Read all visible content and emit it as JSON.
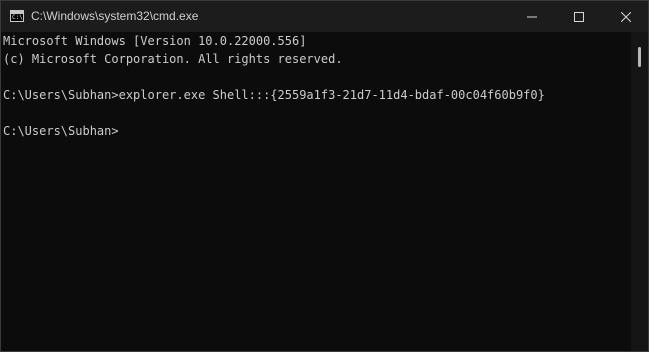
{
  "window": {
    "title": "C:\\Windows\\system32\\cmd.exe",
    "icon": "command-prompt-icon"
  },
  "caption_buttons": {
    "minimize_icon": "minimize-icon",
    "maximize_icon": "maximize-icon",
    "close_icon": "close-icon"
  },
  "console": {
    "lines": [
      "Microsoft Windows [Version 10.0.22000.556]",
      "(c) Microsoft Corporation. All rights reserved.",
      "",
      "C:\\Users\\Subhan>explorer.exe Shell:::{2559a1f3-21d7-11d4-bdaf-00c04f60b9f0}",
      "",
      "C:\\Users\\Subhan>"
    ]
  },
  "icon_glyphs": {
    "app_prompt": "C:\\"
  },
  "colors": {
    "background": "#0c0c0c",
    "titlebar": "#1c1c1c",
    "text": "#cccccc",
    "title_text": "#cfcfcf"
  }
}
